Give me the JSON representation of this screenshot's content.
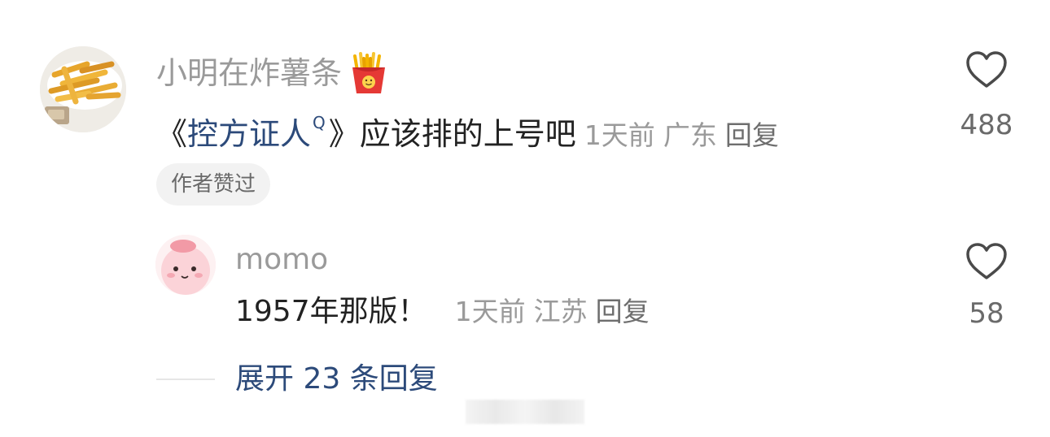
{
  "comment": {
    "username": "小明在炸薯条",
    "username_emoji": "french-fries-emoji",
    "text_open_bracket": "《",
    "link_text": "控方证人",
    "search_mark": "Q",
    "text_close_bracket": "》",
    "text_rest": "应该排的上号吧",
    "time": "1天前",
    "location": "广东",
    "reply_label": "回复",
    "badge": "作者赞过",
    "likes": "488"
  },
  "reply": {
    "username": "momo",
    "text": "1957年那版！",
    "time": "1天前",
    "location": "江苏",
    "reply_label": "回复",
    "likes": "58"
  },
  "expand": {
    "label": "展开 23 条回复"
  },
  "colors": {
    "link": "#2c4a7a",
    "meta": "#9a9a9a",
    "badge_bg": "#f2f2f2"
  }
}
